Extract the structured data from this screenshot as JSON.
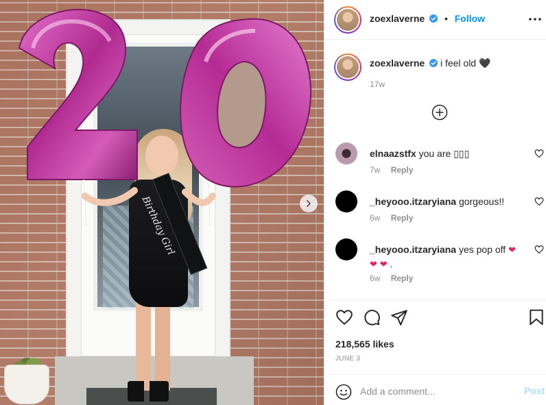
{
  "post": {
    "username": "zoexlaverne",
    "follow_label": "Follow",
    "dot": "•",
    "sash_text": "Birthday Girl",
    "balloon_digits": "20"
  },
  "caption": {
    "username": "zoexlaverne",
    "text": "i feel old",
    "emoji": "🖤",
    "time": "17w"
  },
  "comments": [
    {
      "username": "elnaazstfx",
      "text": "you are ",
      "emoji": "▯▯▯",
      "time": "7w",
      "reply": "Reply"
    },
    {
      "username": "_heyooo.itzaryiana",
      "text": "gorgeous!!",
      "time": "6w",
      "reply": "Reply"
    },
    {
      "username": "_heyooo.itzaryiana",
      "text": "yes pop off",
      "emoji": "❤",
      "emoji2": "❤",
      "emoji3": "❤",
      "tail": " .",
      "time": "6w",
      "reply": "Reply"
    }
  ],
  "actions": {
    "likes": "218,565 likes",
    "date": "JUNE 3",
    "comment_placeholder": "Add a comment...",
    "post_label": "Post"
  },
  "colors": {
    "accent": "#0095f6",
    "balloon": "#c2359f",
    "heart": "#e0245e"
  },
  "icons": [
    "verified-badge-icon",
    "more-options-icon",
    "load-more-plus-icon",
    "heart-icon",
    "comment-icon",
    "share-icon",
    "bookmark-icon",
    "emoji-icon",
    "next-arrow-icon"
  ]
}
